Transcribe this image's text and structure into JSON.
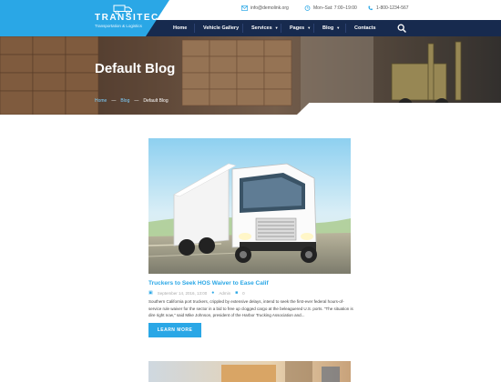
{
  "brand": {
    "name": "TRANSITEC",
    "tagline": "Transportation & Logistics",
    "accent": "#2aa7e6",
    "nav_bg": "#172a4e"
  },
  "contacts": [
    {
      "icon": "envelope-icon",
      "text": "info@demolink.org"
    },
    {
      "icon": "clock-icon",
      "text": "Mon–Sat: 7:00–19:00"
    },
    {
      "icon": "phone-icon",
      "text": "1-800-1234-567"
    }
  ],
  "nav": {
    "items": [
      {
        "label": "Home",
        "dropdown": false
      },
      {
        "label": "Vehicle Gallery",
        "dropdown": false
      },
      {
        "label": "Services",
        "dropdown": true
      },
      {
        "label": "Pages",
        "dropdown": true
      },
      {
        "label": "Blog",
        "dropdown": true
      },
      {
        "label": "Contacts",
        "dropdown": false
      }
    ],
    "search_icon": "search-icon"
  },
  "hero": {
    "title": "Default Blog",
    "breadcrumb": [
      "Home",
      "Blog",
      "Default Blog"
    ],
    "separator": "—"
  },
  "post": {
    "title": "Truckers to Seek HOS Waiver to Ease Calif",
    "date": "September 14, 2016, 13:00",
    "author": "Admin",
    "comments": "0",
    "excerpt": "Southern California port truckers, crippled by extensive delays, intend to seek the first-ever federal hours-of-service rule waiver for the sector in a bid to free up clogged cargo at the beleaguered U.S. ports. \"The situation is dire right now,\" said Mike Johnson, president of the Harbor Trucking Association and...",
    "button": "LEARN MORE"
  }
}
